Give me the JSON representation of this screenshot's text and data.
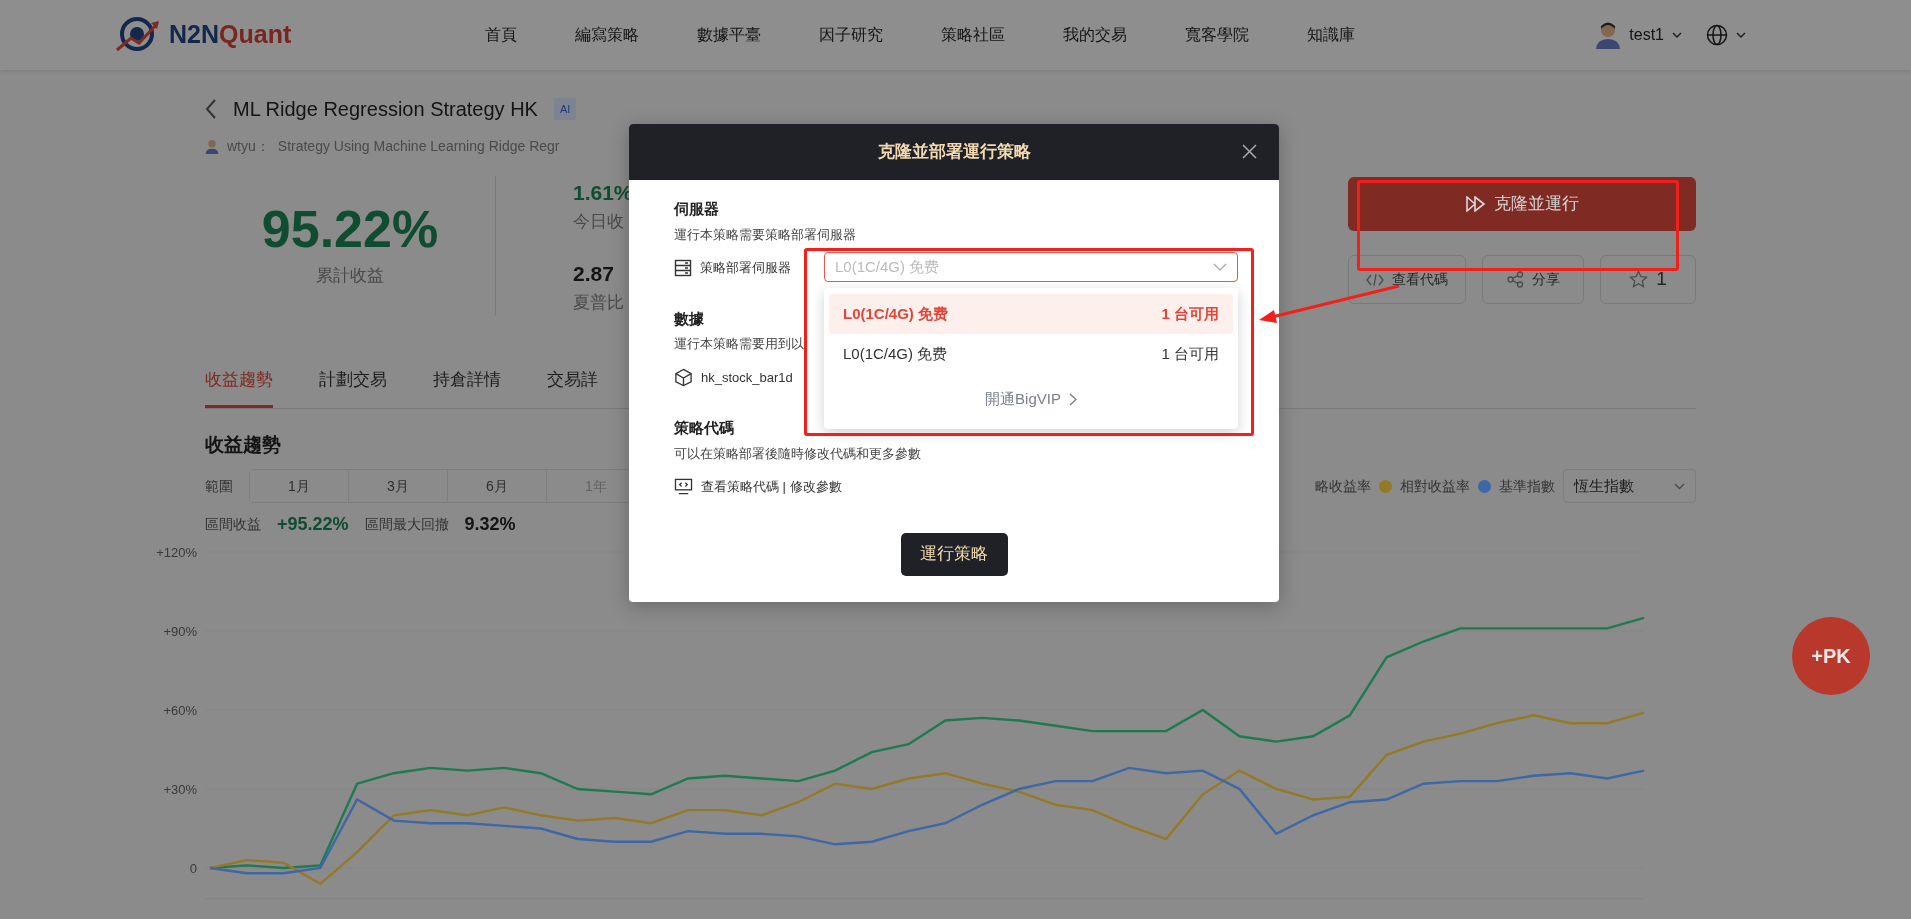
{
  "header": {
    "logo_words": [
      "N2N",
      "Quant"
    ],
    "nav": [
      "首頁",
      "編寫策略",
      "數據平臺",
      "因子研究",
      "策略社區",
      "我的交易",
      "寬客學院",
      "知識庫"
    ],
    "user": "test1"
  },
  "strategy": {
    "title": "ML Ridge Regression Strategy HK",
    "badge": "AI",
    "author": "wtyu：",
    "description": "Strategy Using Machine Learning Ridge Regr"
  },
  "stats": {
    "main_value": "95.22%",
    "main_label": "累計收益",
    "items": [
      {
        "value": "1.61%",
        "label": "今日收",
        "kind": "positive"
      },
      {
        "value": "2.87",
        "label": "夏普比",
        "kind": "neutral"
      }
    ]
  },
  "actions": {
    "primary": "克隆並運行",
    "buttons": [
      {
        "label": "查看代碼",
        "kind": "code"
      },
      {
        "label": "分享",
        "kind": "share"
      },
      {
        "label": "1",
        "kind": "star"
      }
    ]
  },
  "tabs": [
    {
      "label": "收益趨勢",
      "selected": true
    },
    {
      "label": "計劃交易",
      "selected": false
    },
    {
      "label": "持倉詳情",
      "selected": false
    },
    {
      "label": "交易詳",
      "selected": false
    }
  ],
  "trend": {
    "heading": "收益趨勢",
    "range_label": "範圍",
    "ranges": [
      {
        "label": "1月",
        "disabled": false
      },
      {
        "label": "3月",
        "disabled": false
      },
      {
        "label": "6月",
        "disabled": false
      },
      {
        "label": "1年",
        "disabled": true
      }
    ],
    "benchmark": "恆生指數",
    "interval_label": "區間收益",
    "interval_value": "+95.22%",
    "drawdown_label": "區間最大回撤",
    "drawdown_value": "9.32%",
    "chart_data": {
      "type": "line",
      "ylim": [
        -12,
        120
      ],
      "yticks": [
        {
          "value": 120,
          "label": "+120%"
        },
        {
          "value": 90,
          "label": "+90%"
        },
        {
          "value": 60,
          "label": "+60%"
        },
        {
          "value": 30,
          "label": "+30%"
        },
        {
          "value": 0,
          "label": "0"
        }
      ],
      "series": [
        {
          "name": "略收益率",
          "color": "#1f7a52",
          "values": [
            0,
            1,
            0,
            1,
            32,
            36,
            38,
            37,
            38,
            36,
            30,
            29,
            28,
            34,
            35,
            34,
            33,
            37,
            44,
            47,
            56,
            57,
            56,
            54,
            52,
            52,
            52,
            60,
            50,
            48,
            50,
            58,
            80,
            86,
            91,
            91,
            91,
            91,
            91,
            95
          ]
        },
        {
          "name": "相對收益率",
          "color": "#947a27",
          "values": [
            0,
            3,
            2,
            -6,
            6,
            20,
            22,
            20,
            23,
            20,
            18,
            19,
            17,
            22,
            22,
            20,
            25,
            32,
            30,
            34,
            36,
            32,
            29,
            24,
            22,
            16,
            11,
            28,
            37,
            30,
            26,
            27,
            43,
            48,
            51,
            55,
            58,
            55,
            55,
            59
          ]
        },
        {
          "name": "基準指數",
          "color": "#3d67a6",
          "values": [
            0,
            -2,
            -2,
            0,
            26,
            18,
            17,
            17,
            16,
            15,
            11,
            10,
            10,
            14,
            13,
            13,
            12,
            9,
            10,
            14,
            17,
            24,
            30,
            33,
            33,
            38,
            36,
            37,
            30,
            13,
            20,
            25,
            26,
            32,
            33,
            33,
            35,
            36,
            34,
            37
          ]
        }
      ]
    }
  },
  "pk_button": "+PK",
  "modal": {
    "title": "克隆並部署運行策略",
    "sections": [
      {
        "heading": "伺服器",
        "text": "運行本策略需要策略部署伺服器",
        "kind": "server",
        "item": "策略部署伺服器"
      },
      {
        "heading": "數據",
        "text": "運行本策略需要用到以",
        "kind": "data",
        "item": "hk_stock_bar1d"
      },
      {
        "heading": "策略代碼",
        "text": "可以在策略部署後隨時修改代碼和更多參數",
        "kind": "code",
        "item": "查看策略代碼 | 修改參數"
      }
    ],
    "select": {
      "placeholder": "L0(1C/4G) 免费",
      "expanded": true,
      "options": [
        {
          "label": "L0(1C/4G) 免费",
          "count": "1 台可用",
          "selected": true
        },
        {
          "label": "L0(1C/4G) 免费",
          "count": "1 台可用",
          "selected": false
        }
      ],
      "footer_link": "開通BigVIP"
    },
    "run_button": "運行策略"
  }
}
